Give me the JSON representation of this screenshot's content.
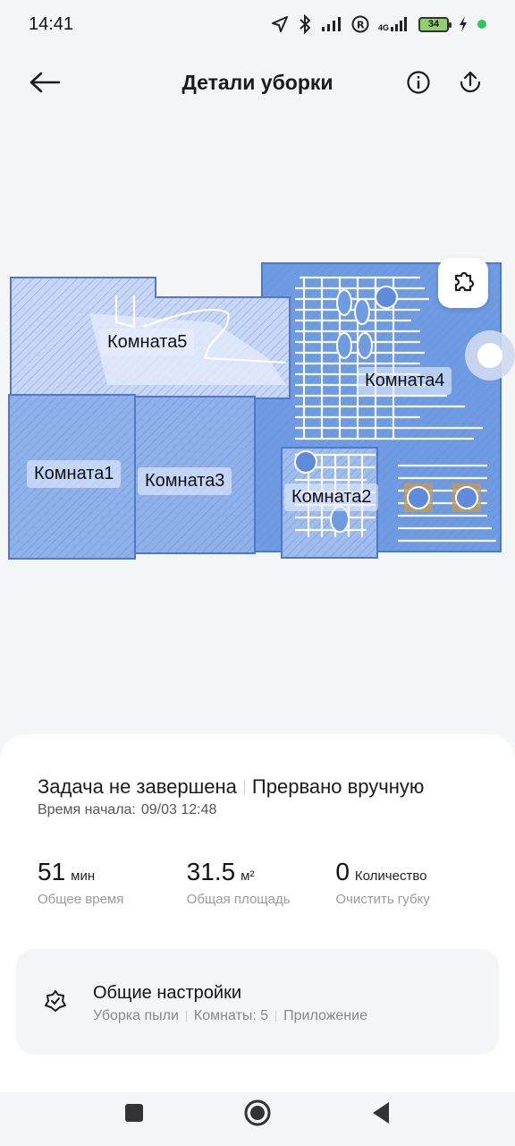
{
  "status_bar": {
    "time": "14:41",
    "network": "4G",
    "battery": "34",
    "icons": [
      "location-icon",
      "bluetooth-icon",
      "signal-icon",
      "roaming-icon",
      "signal-4g-icon",
      "battery-icon",
      "charging-icon",
      "dot-icon"
    ]
  },
  "header": {
    "title": "Детали уборки",
    "back_icon": "back-arrow-icon",
    "info_icon": "info-icon",
    "share_icon": "share-icon"
  },
  "map": {
    "rooms": [
      "Комната5",
      "Комната1",
      "Комната3",
      "Комната4",
      "Комната2"
    ],
    "tool_icon": "puzzle-edit-icon",
    "colors": {
      "room_fill": "#7fa6e6",
      "room_light": "#c7d7f5",
      "room_stroke": "#4f78c8",
      "path": "#ffffff"
    }
  },
  "summary": {
    "status": "Задача не завершена",
    "reason": "Прервано вручную",
    "start_label": "Время начала:",
    "start_value": "09/03 12:48"
  },
  "stats": [
    {
      "value": "51",
      "unit": "мин",
      "label": "Общее время"
    },
    {
      "value": "31.5",
      "unit": "м²",
      "label": "Общая площадь"
    },
    {
      "value": "0",
      "unit": "Количество",
      "label": "Очистить губку"
    }
  ],
  "settings": {
    "title": "Общие настройки",
    "details": [
      "Уборка пыли",
      "Комнаты: 5",
      "Приложение"
    ],
    "icon": "cleaning-settings-icon"
  },
  "nav": {
    "icons": [
      "recents-square-icon",
      "home-circle-icon",
      "back-triangle-icon"
    ]
  }
}
